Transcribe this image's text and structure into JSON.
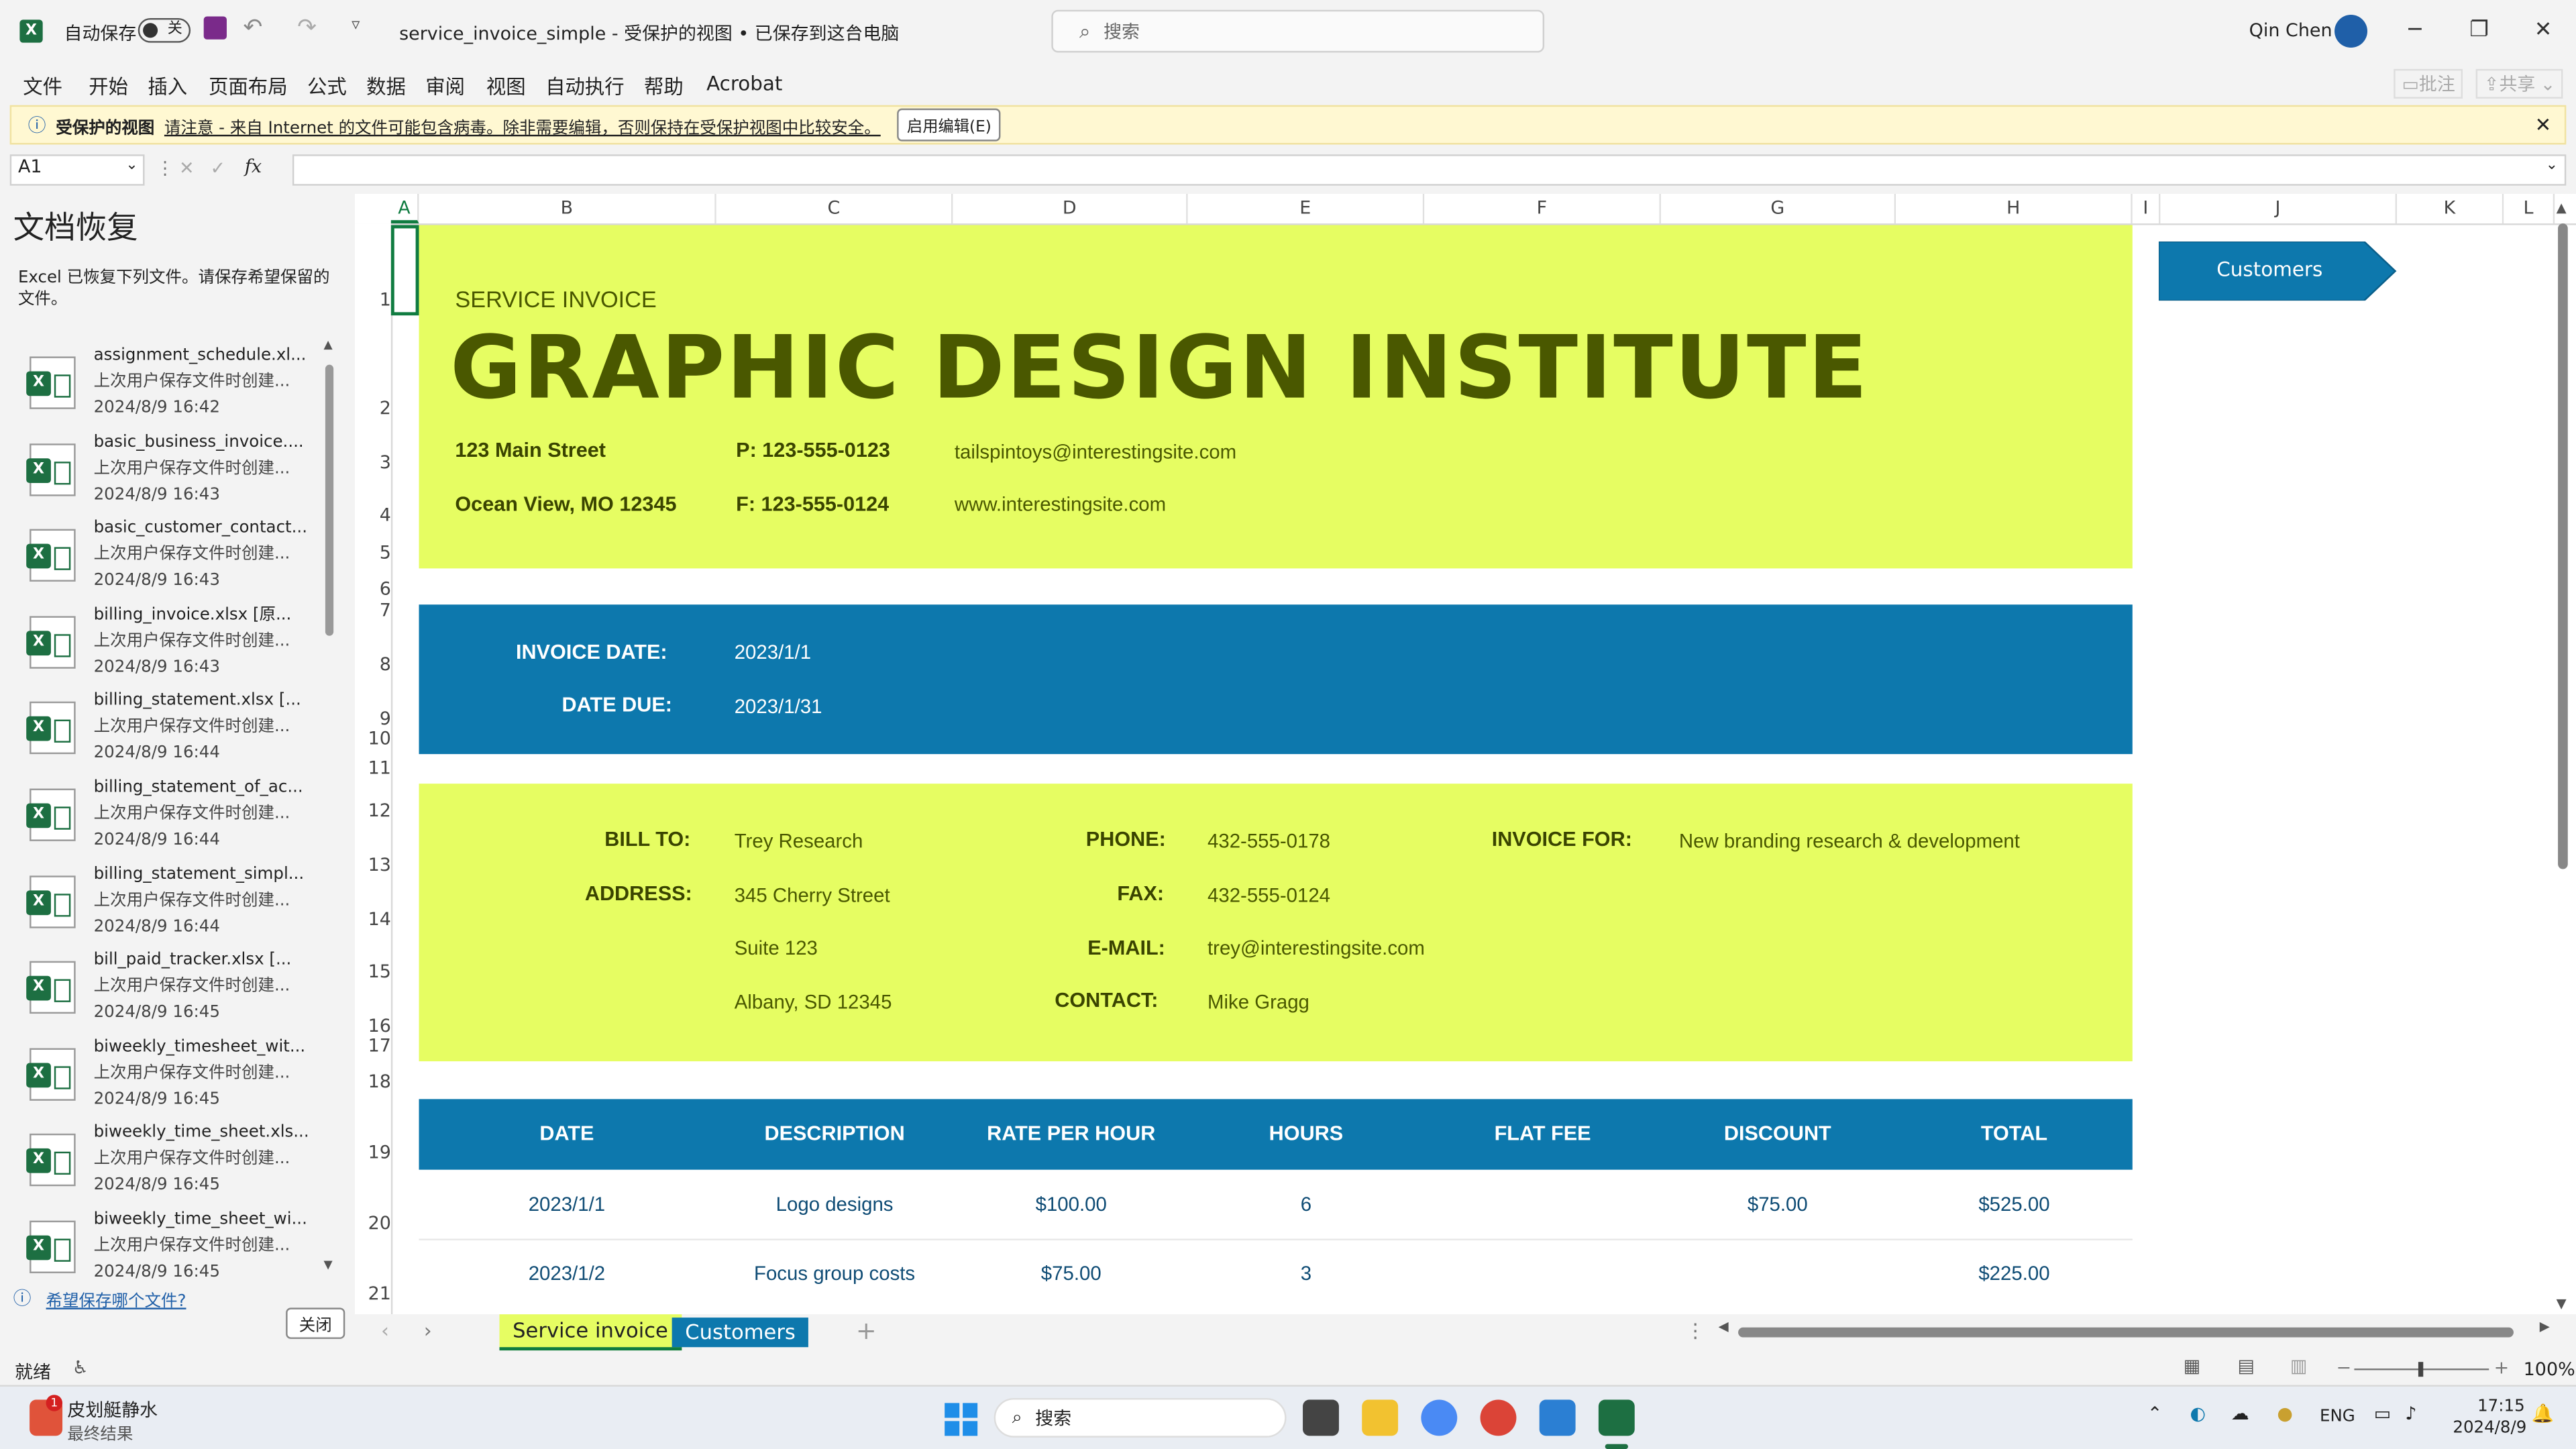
{
  "titlebar": {
    "autosave_label": "自动保存",
    "autosave_state": "关",
    "doc_title": "service_invoice_simple  -  受保护的视图 • 已保存到这台电脑",
    "search_placeholder": "搜索",
    "user_name": "Qin Chen",
    "minimize": "─",
    "restore": "❐",
    "close": "✕"
  },
  "menu": [
    "文件",
    "开始",
    "插入",
    "页面布局",
    "公式",
    "数据",
    "审阅",
    "视图",
    "自动执行",
    "帮助",
    "Acrobat"
  ],
  "menu_right": {
    "comments": "批注",
    "share": "共享"
  },
  "banner": {
    "title": "受保护的视图",
    "message": "请注意 - 来自 Internet 的文件可能包含病毒。除非需要编辑，否则保持在受保护视图中比较安全。",
    "enable_button": "启用编辑(E)"
  },
  "formula_bar": {
    "cell_ref": "A1",
    "fx": "fx",
    "value": ""
  },
  "recovery": {
    "title": "文档恢复",
    "description": "Excel 已恢复下列文件。请保存希望保留的文件。",
    "items": [
      {
        "name": "assignment_schedule.xl...",
        "status": "上次用户保存文件时创建...",
        "time": "2024/8/9 16:42"
      },
      {
        "name": "basic_business_invoice....",
        "status": "上次用户保存文件时创建...",
        "time": "2024/8/9 16:43"
      },
      {
        "name": "basic_customer_contact...",
        "status": "上次用户保存文件时创建...",
        "time": "2024/8/9 16:43"
      },
      {
        "name": "billing_invoice.xlsx  [原...",
        "status": "上次用户保存文件时创建...",
        "time": "2024/8/9 16:43"
      },
      {
        "name": "billing_statement.xlsx  [...",
        "status": "上次用户保存文件时创建...",
        "time": "2024/8/9 16:44"
      },
      {
        "name": "billing_statement_of_ac...",
        "status": "上次用户保存文件时创建...",
        "time": "2024/8/9 16:44"
      },
      {
        "name": "billing_statement_simpl...",
        "status": "上次用户保存文件时创建...",
        "time": "2024/8/9 16:44"
      },
      {
        "name": "bill_paid_tracker.xlsx  [...",
        "status": "上次用户保存文件时创建...",
        "time": "2024/8/9 16:45"
      },
      {
        "name": "biweekly_timesheet_wit...",
        "status": "上次用户保存文件时创建...",
        "time": "2024/8/9 16:45"
      },
      {
        "name": "biweekly_time_sheet.xls...",
        "status": "上次用户保存文件时创建...",
        "time": "2024/8/9 16:45"
      },
      {
        "name": "biweekly_time_sheet_wi...",
        "status": "上次用户保存文件时创建...",
        "time": "2024/8/9 16:45"
      }
    ],
    "help_link": "希望保存哪个文件?",
    "close_button": "关闭"
  },
  "columns": [
    "A",
    "B",
    "C",
    "D",
    "E",
    "F",
    "G",
    "H",
    "I",
    "J",
    "K",
    "L"
  ],
  "rows": [
    "1",
    "2",
    "3",
    "4",
    "5",
    "6",
    "7",
    "8",
    "9",
    "10",
    "11",
    "12",
    "13",
    "14",
    "15",
    "16",
    "17",
    "18",
    "19",
    "20",
    "21"
  ],
  "invoice": {
    "subtitle": "SERVICE INVOICE",
    "company": "GRAPHIC DESIGN INSTITUTE",
    "street": "123 Main Street",
    "city": "Ocean View, MO 12345",
    "phone": "P: 123-555-0123",
    "fax": "F: 123-555-0124",
    "email": "tailspintoys@interestingsite.com",
    "website": "www.interestingsite.com",
    "invoice_date_label": "INVOICE DATE:",
    "invoice_date": "2023/1/1",
    "date_due_label": "DATE DUE:",
    "date_due": "2023/1/31",
    "bill_to_label": "BILL TO:",
    "bill_to": "Trey Research",
    "address_label": "ADDRESS:",
    "address1": "345 Cherry Street",
    "address2": "Suite 123",
    "address3": "Albany, SD 12345",
    "phone_label": "PHONE:",
    "client_phone": "432-555-0178",
    "fax_label": "FAX:",
    "client_fax": "432-555-0124",
    "email_label": "E-MAIL:",
    "client_email": "trey@interestingsite.com",
    "contact_label": "CONTACT:",
    "contact": "Mike Gragg",
    "invoice_for_label": "INVOICE FOR:",
    "invoice_for": "New branding research & development",
    "table_headers": [
      "DATE",
      "DESCRIPTION",
      "RATE PER HOUR",
      "HOURS",
      "FLAT FEE",
      "DISCOUNT",
      "TOTAL"
    ],
    "table_rows": [
      [
        "2023/1/1",
        "Logo designs",
        "$100.00",
        "6",
        "",
        "$75.00",
        "$525.00"
      ],
      [
        "2023/1/2",
        "Focus group costs",
        "$75.00",
        "3",
        "",
        "",
        "$225.00"
      ]
    ],
    "customers_button": "Customers"
  },
  "tabs": {
    "active": "Service invoice",
    "other": "Customers",
    "add": "+"
  },
  "status": {
    "ready": "就绪",
    "zoom": "100%"
  },
  "taskbar": {
    "weather_title": "皮划艇静水",
    "weather_sub": "最终结果",
    "search": "搜索",
    "lang": "ENG",
    "time": "17:15",
    "date": "2024/8/9"
  },
  "colors": {
    "lime": "#e6fd62",
    "blue": "#0d78ad",
    "olive": "#4a5800",
    "navy_text": "#0f4c75"
  }
}
